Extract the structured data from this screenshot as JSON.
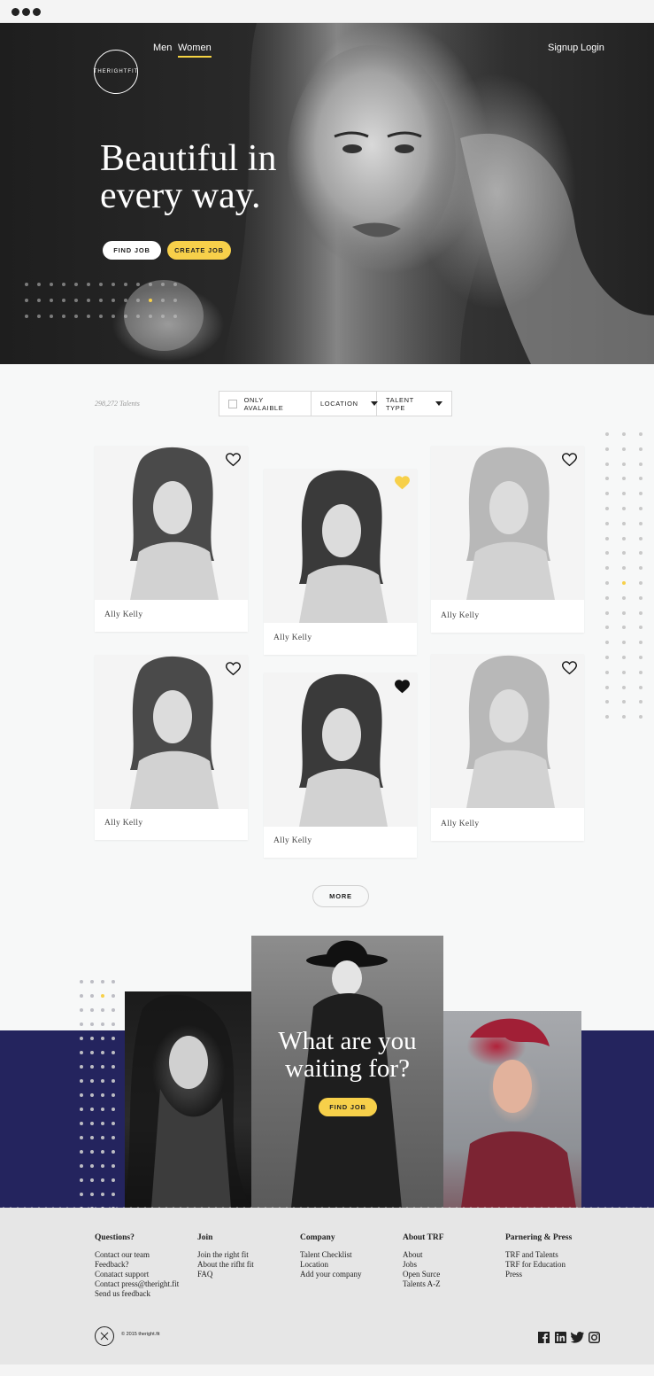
{
  "nav": {
    "logo_text": "THERIGHTFIT",
    "men": "Men",
    "women": "Women",
    "signup": "Signup",
    "login": "Login"
  },
  "hero": {
    "title_line1": "Beautiful in",
    "title_line2": "every way.",
    "find_job": "FIND JOB",
    "create_job": "CREATE JOB"
  },
  "filters": {
    "talent_count": "298,272 Talents",
    "only_available": "ONLY AVALAIBLE",
    "location": "LOCATION",
    "talent_type": "TALENT TYPE"
  },
  "talents": [
    {
      "name": "Ally Kelly",
      "favorite": "none"
    },
    {
      "name": "Ally Kelly",
      "favorite": "yellow"
    },
    {
      "name": "Ally Kelly",
      "favorite": "none"
    },
    {
      "name": "Ally Kelly",
      "favorite": "none"
    },
    {
      "name": "Ally Kelly",
      "favorite": "black"
    },
    {
      "name": "Ally Kelly",
      "favorite": "none"
    }
  ],
  "more_label": "MORE",
  "promo": {
    "title_line1": "What are you",
    "title_line2": "waiting for?",
    "find_job": "FIND JOB"
  },
  "footer": {
    "columns": [
      {
        "heading": "Questions?",
        "links": [
          "Contact our team",
          "Feedback?",
          "Conatact support",
          "Contact press@theright.fit",
          "Send us feedback"
        ]
      },
      {
        "heading": "Join",
        "links": [
          "Join the right fit",
          "About the rifht fit",
          "FAQ"
        ]
      },
      {
        "heading": "Company",
        "links": [
          "Talent Checklist",
          "Location",
          "Add your company"
        ]
      },
      {
        "heading": "About TRF",
        "links": [
          "About",
          "Jobs",
          "Open Surce",
          "Talents A-Z"
        ]
      },
      {
        "heading": "Parnering & Press",
        "links": [
          "TRF and Talents",
          "TRF for Education",
          "Press"
        ]
      }
    ],
    "copyright": "© 2015 theright.fit",
    "social_icons": [
      "facebook-icon",
      "linkedin-icon",
      "twitter-icon",
      "instagram-icon"
    ]
  },
  "colors": {
    "accent_yellow": "#f7d04a",
    "promo_navy": "#24245e",
    "footer_gray": "#e6e6e6"
  }
}
